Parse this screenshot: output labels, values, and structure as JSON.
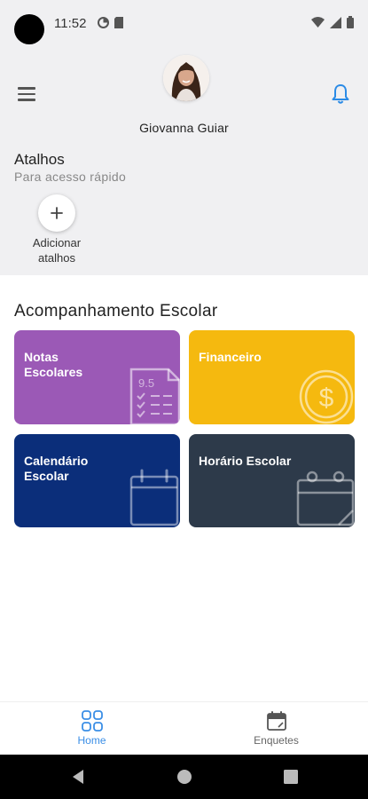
{
  "status_bar": {
    "time": "11:52"
  },
  "header": {
    "user_name": "Giovanna Guiar",
    "shortcuts_title": "Atalhos",
    "shortcuts_subtitle": "Para acesso rápido",
    "add_shortcut_label": "Adicionar atalhos"
  },
  "main": {
    "section_title": "Acompanhamento Escolar",
    "tiles": [
      {
        "label": "Notas Escolares",
        "color": "#9b59b6",
        "icon": "report-card-icon",
        "grade_text": "9.5"
      },
      {
        "label": "Financeiro",
        "color": "#f5b90f",
        "icon": "dollar-coin-icon"
      },
      {
        "label": "Calendário Escolar",
        "color": "#0b2e7a",
        "icon": "calendar-icon"
      },
      {
        "label": "Horário Escolar",
        "color": "#2d3a4a",
        "icon": "schedule-icon"
      }
    ]
  },
  "bottom_nav": {
    "items": [
      {
        "label": "Home",
        "icon": "home-grid-icon",
        "active": true,
        "color": "#3a8ee6"
      },
      {
        "label": "Enquetes",
        "icon": "poll-calendar-icon",
        "active": false,
        "color": "#666666"
      }
    ]
  }
}
